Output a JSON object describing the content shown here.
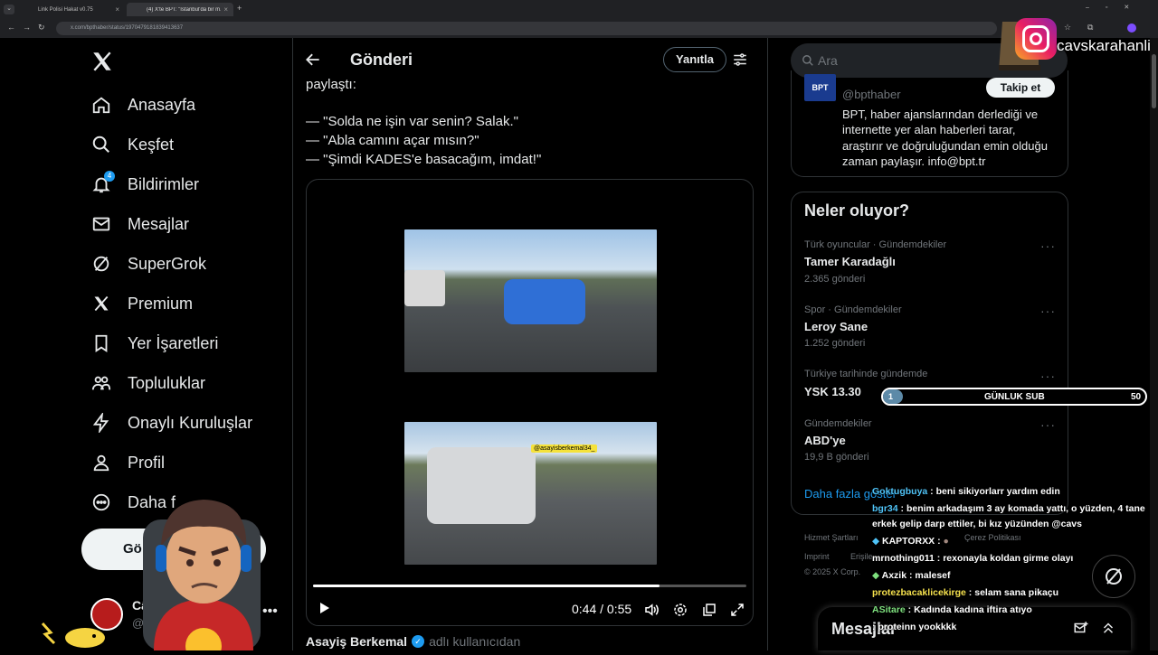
{
  "browser": {
    "tabs": [
      {
        "title": "Link Polisi Hakat v0.75"
      },
      {
        "title": "(4) X'te BPT: \"İstanbul'da bir m..."
      }
    ],
    "url": "x.com/bpthaber/status/1970479181839413637"
  },
  "sidebar": {
    "items": [
      {
        "label": "Anasayfa",
        "icon": "home-icon"
      },
      {
        "label": "Keşfet",
        "icon": "search-icon"
      },
      {
        "label": "Bildirimler",
        "icon": "bell-icon",
        "badge": "4"
      },
      {
        "label": "Mesajlar",
        "icon": "mail-icon"
      },
      {
        "label": "SuperGrok",
        "icon": "grok-icon"
      },
      {
        "label": "Premium",
        "icon": "x-logo-icon"
      },
      {
        "label": "Yer İşaretleri",
        "icon": "bookmark-icon"
      },
      {
        "label": "Topluluklar",
        "icon": "communities-icon"
      },
      {
        "label": "Onaylı Kuruluşlar",
        "icon": "lightning-icon"
      },
      {
        "label": "Profil",
        "icon": "person-icon"
      },
      {
        "label": "Daha f",
        "icon": "more-icon"
      }
    ],
    "post_button": "Gö",
    "account_name": "Câ",
    "account_handle": "@c"
  },
  "main": {
    "header_title": "Gönderi",
    "reply_button": "Yanıtla",
    "tweet_lines": [
      "paylaştı:",
      "— \"Solda ne işin var senin? Salak.\"",
      "— \"Abla camını açar mısın?\"",
      "— \"Şimdi KADES'e basacağım, imdat!\""
    ],
    "video": {
      "watermark": "@asayisberkemal34_",
      "time_current": "0:44",
      "time_total": "0:55",
      "progress": 0.8
    },
    "source_name": "Asayiş Berkemal",
    "source_suffix": "adlı kullanıcıdan"
  },
  "right": {
    "search_placeholder": "Ara",
    "profile": {
      "handle": "@bpthaber",
      "follow_button": "Takip et",
      "bio": [
        "BPT, haber ajanslarından derlediği ve",
        "internette yer alan haberleri tarar,",
        "araştırır ve doğruluğundan emin olduğu",
        "zaman paylaşır. info@bpt.tr"
      ]
    },
    "trends_title": "Neler oluyor?",
    "trends": [
      {
        "category": "Türk oyuncular · Gündemdekiler",
        "name": "Tamer Karadağlı",
        "count": "2.365 gönderi"
      },
      {
        "category": "Spor · Gündemdekiler",
        "name": "Leroy Sane",
        "count": "1.252 gönderi"
      },
      {
        "category": "Türkiye tarihinde gündemde",
        "name": "YSK 13.30",
        "count": ""
      },
      {
        "category": "Gündemdekiler",
        "name": "ABD'ye",
        "count": "19,9 B gönderi"
      }
    ],
    "show_more": "Daha fazla göster",
    "footer": [
      "Hizmet Şartları",
      "Çerez Politikası",
      "Imprint",
      "Erişile",
      "© 2025 X Corp."
    ],
    "messages_label": "Mesajlar"
  },
  "overlay": {
    "instagram_name": "cavskarahanli",
    "sub_goal": {
      "current": "1",
      "label": "GÜNLUK SUB",
      "target": "50",
      "progress": 0.02
    },
    "chat": [
      {
        "user": "Goktugbuya",
        "color": "#4fc3f7",
        "msg": "beni sikiyorlarr yardım edin"
      },
      {
        "user": "bgr34",
        "color": "#4fc3f7",
        "msg": "benim arkadaşım 3 ay komada yattı, o yüzden, 4 tane"
      },
      {
        "user": "",
        "color": "#ffffff",
        "msg": "erkek gelip darp ettiler, bi kız yüzünden @cavs"
      },
      {
        "user": "KAPTORXX",
        "color": "#ffffff",
        "msg": ""
      },
      {
        "user": "mrnothing011",
        "color": "#ffffff",
        "msg": "rexonayla koldan girme olayı"
      },
      {
        "user": "Axzik",
        "color": "#ffffff",
        "msg": "malesef"
      },
      {
        "user": "protezbacaklicekirge",
        "color": "#f4e04d",
        "msg": "selam sana pikaçu"
      },
      {
        "user": "ASitare",
        "color": "#7ee07e",
        "msg": "Kadında kadına iftira atıyo"
      },
      {
        "user": "",
        "color": "#ffffff",
        "msg": "proteinn yookkkk"
      }
    ]
  }
}
